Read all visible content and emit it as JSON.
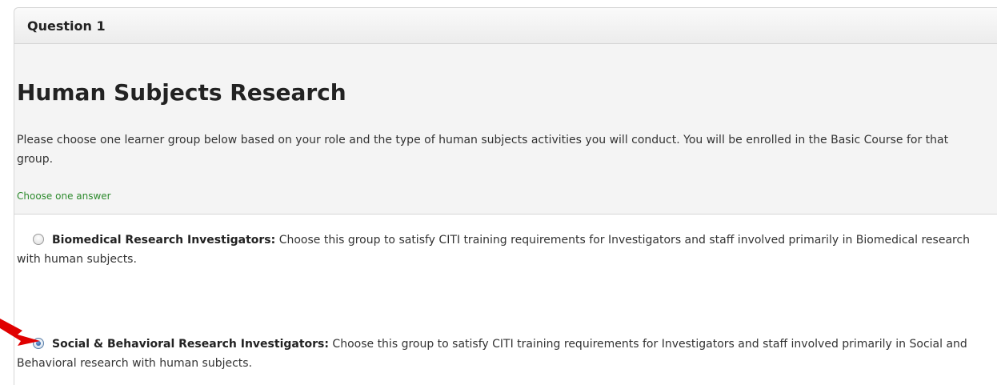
{
  "question": {
    "header": "Question 1",
    "title": "Human Subjects Research",
    "description": "Please choose one learner group below based on your role and the type of human subjects activities you will conduct. You will be enrolled in the Basic Course for that group.",
    "hint": "Choose one answer"
  },
  "answers": [
    {
      "label": "Biomedical Research Investigators:",
      "text": " Choose this group to satisfy CITI training requirements for Investigators and staff involved primarily in Biomedical research with human subjects.",
      "selected": false
    },
    {
      "label": "Social & Behavioral Research Investigators:",
      "text": " Choose this group to satisfy CITI training requirements for Investigators and staff involved primarily in Social and Behavioral research with human subjects.",
      "selected": true
    }
  ],
  "colors": {
    "hint": "#2e8b2e",
    "arrow": "#e00000",
    "radio_selected": "#1f4f8f"
  },
  "icons": {
    "annotation": "red-arrow-icon"
  }
}
